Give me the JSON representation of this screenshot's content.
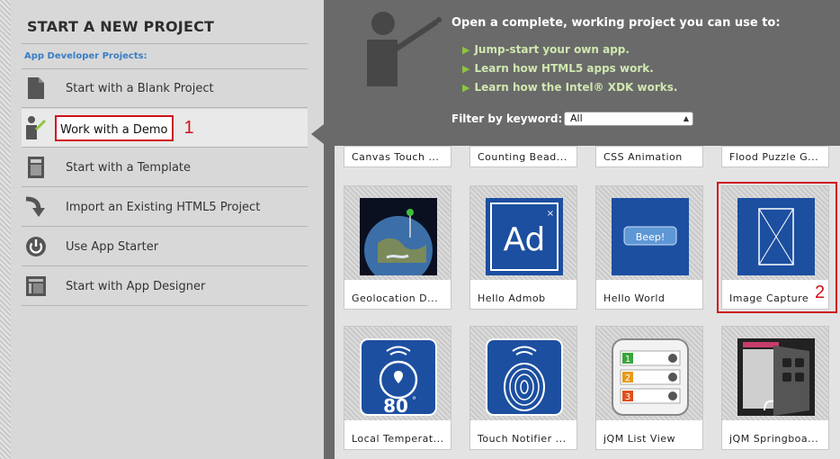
{
  "left": {
    "title": "START A NEW PROJECT",
    "section": "App Developer Projects:",
    "items": [
      {
        "label": "Start with a Blank Project",
        "icon": "document-icon"
      },
      {
        "label": "Work with a Demo",
        "icon": "presenter-icon",
        "active": true
      },
      {
        "label": "Start with a Template",
        "icon": "template-icon"
      },
      {
        "label": "Import an Existing HTML5 Project",
        "icon": "import-arrow-icon"
      },
      {
        "label": "Use App Starter",
        "icon": "power-icon"
      },
      {
        "label": "Start with App Designer",
        "icon": "designer-icon"
      }
    ],
    "marker1": "1"
  },
  "right": {
    "heading": "Open a complete, working project you can use to:",
    "bullets": [
      "Jump-start your own app.",
      "Learn how HTML5 apps work.",
      "Learn how the Intel® XDK works."
    ],
    "filter_label": "Filter by keyword:",
    "filter_value": "All",
    "marker2": "2",
    "top_row": [
      "Canvas Touch ...",
      "Counting Bead...",
      "CSS Animation",
      "Flood Puzzle G..."
    ],
    "tiles": [
      {
        "label": "Geolocation D...",
        "icon": "earth-icon"
      },
      {
        "label": "Hello Admob",
        "icon": "ad-icon"
      },
      {
        "label": "Hello World",
        "icon": "beep-button-icon",
        "button_text": "Beep!"
      },
      {
        "label": "Image Capture",
        "icon": "image-placeholder-icon"
      },
      {
        "label": "Local Temperat...",
        "icon": "thermometer-location-icon",
        "value": "80",
        "unit": "°"
      },
      {
        "label": "Touch Notifier ...",
        "icon": "fingerprint-icon"
      },
      {
        "label": "jQM List View",
        "icon": "list-view-icon",
        "rows": [
          "1",
          "2",
          "3"
        ]
      },
      {
        "label": "jQM Springboa...",
        "icon": "springboard-icon"
      }
    ]
  },
  "colors": {
    "accent_red": "#d0121b",
    "section_blue": "#3a7dc4",
    "bullet_green": "#8cc63f"
  }
}
